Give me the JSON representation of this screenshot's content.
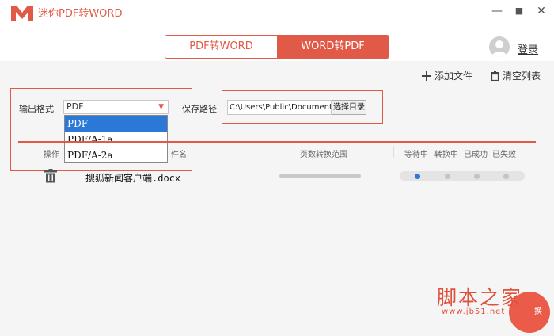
{
  "app": {
    "title": "迷你PDF转WORD"
  },
  "window_controls": {
    "minimize": "—",
    "maximize": "■",
    "close": "✕"
  },
  "tabs": [
    {
      "label": "PDF转WORD",
      "active": false
    },
    {
      "label": "WORD转PDF",
      "active": true
    }
  ],
  "user": {
    "login_label": "登录",
    "avatar_icon": "user-avatar-icon"
  },
  "toolbar": {
    "add_file": "添加文件",
    "add_icon": "plus-icon",
    "clear_list": "清空列表",
    "clear_icon": "trash-icon"
  },
  "output_format": {
    "label": "输出格式",
    "selected": "PDF",
    "options": [
      "PDF",
      "PDF/A-1a",
      "PDF/A-2a"
    ],
    "highlighted_index": 0
  },
  "save_path": {
    "label": "保存路径",
    "value": "C:\\Users\\Public\\Documents",
    "browse_button": "选择目录"
  },
  "table": {
    "headers": {
      "action": "操作",
      "filename": "件名",
      "page_range": "页数转换范围",
      "waiting": "等待中",
      "converting": "转换中",
      "success": "已成功",
      "failed": "已失败"
    },
    "rows": [
      {
        "filename": "搜狐新闻客户端.docx",
        "status": "waiting"
      }
    ]
  },
  "convert_button": "换",
  "watermark": {
    "text": "脚本之家",
    "url": "www.jb51.net"
  },
  "colors": {
    "accent": "#e05a47",
    "selected_option": "#2b78d6",
    "status_active": "#2b78d6",
    "status_inactive": "#c4c4c4"
  }
}
